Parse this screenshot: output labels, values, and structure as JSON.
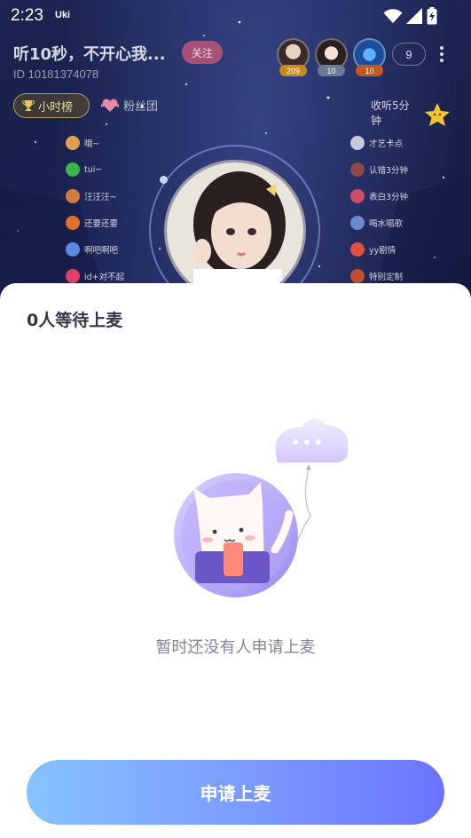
{
  "status_bar": {
    "time": "2:23",
    "app_label": "Uki",
    "icons": [
      "wifi-icon",
      "signal-icon",
      "battery-charging-icon"
    ]
  },
  "room": {
    "title": "听10秒，不开心我...",
    "id_text": "ID 10181374078",
    "follow_label": "关注",
    "online_count": "9",
    "audience": [
      {
        "badge": "209",
        "badge_color": "#c98a1e"
      },
      {
        "badge": "10",
        "badge_color": "#6b7a90"
      },
      {
        "badge": "10",
        "badge_color": "#c05a1e"
      }
    ],
    "rank_label": "小时榜",
    "fans_label": "粉丝团",
    "listen_task": "收听5分钟"
  },
  "gift_menu": {
    "left": [
      "哦~",
      "tui~",
      "汪汪汪~",
      "还要还要",
      "啊吧啊吧",
      "id+对不起"
    ],
    "right": [
      "才艺卡点",
      "认错3分钟",
      "表白3分钟",
      "喝水唱歌",
      "yy剧情",
      "特别定制"
    ]
  },
  "sheet": {
    "title": "0人等待上麦",
    "empty_text": "暂时还没有人申请上麦",
    "apply_label": "申请上麦"
  },
  "colors": {
    "accent_start": "#86c3ff",
    "accent_end": "#6b73ff",
    "sheet_title": "#333645",
    "empty_text": "#808696"
  }
}
